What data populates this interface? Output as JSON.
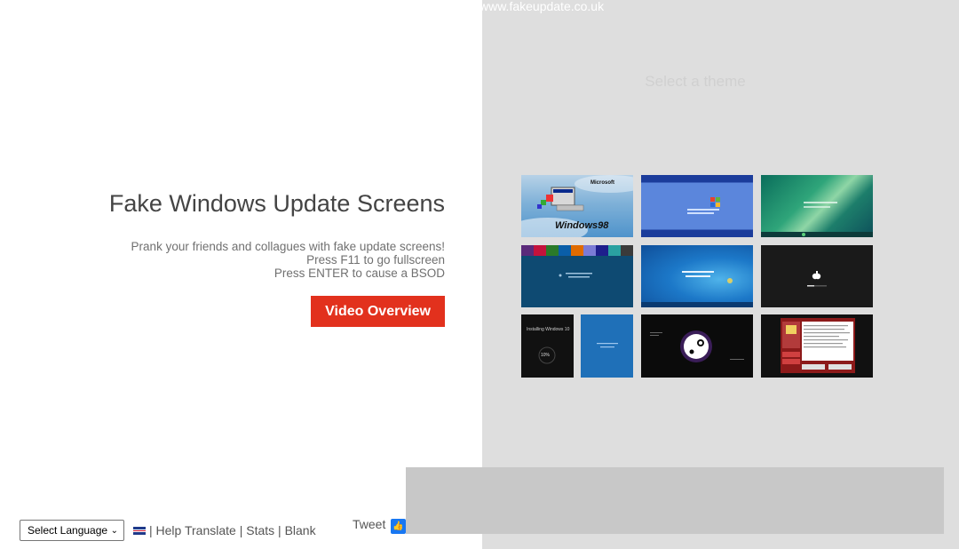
{
  "site_url": "www.fakeupdate.co.uk",
  "select_theme_label": "Select a theme",
  "hero": {
    "title": "Fake Windows Update Screens",
    "line1": "Prank your friends and collagues with fake update screens!",
    "line2": "Press F11 to go fullscreen",
    "line3": "Press ENTER to cause a BSOD",
    "video_button": "Video Overview"
  },
  "themes": {
    "win98_logo": "Windows98",
    "win98_brand": "Microsoft",
    "win10_text": "Installing Windows 10",
    "win10_percent": "10%"
  },
  "footer": {
    "language_select": "Select Language",
    "help_translate": "Help Translate",
    "stats": "Stats",
    "blank": "Blank",
    "tweet": "Tweet"
  },
  "colors": {
    "accent_red": "#e2311d",
    "right_panel_bg": "#dedede"
  },
  "icons": {
    "flag": "uk-flag-icon",
    "like": "facebook-like-icon"
  }
}
